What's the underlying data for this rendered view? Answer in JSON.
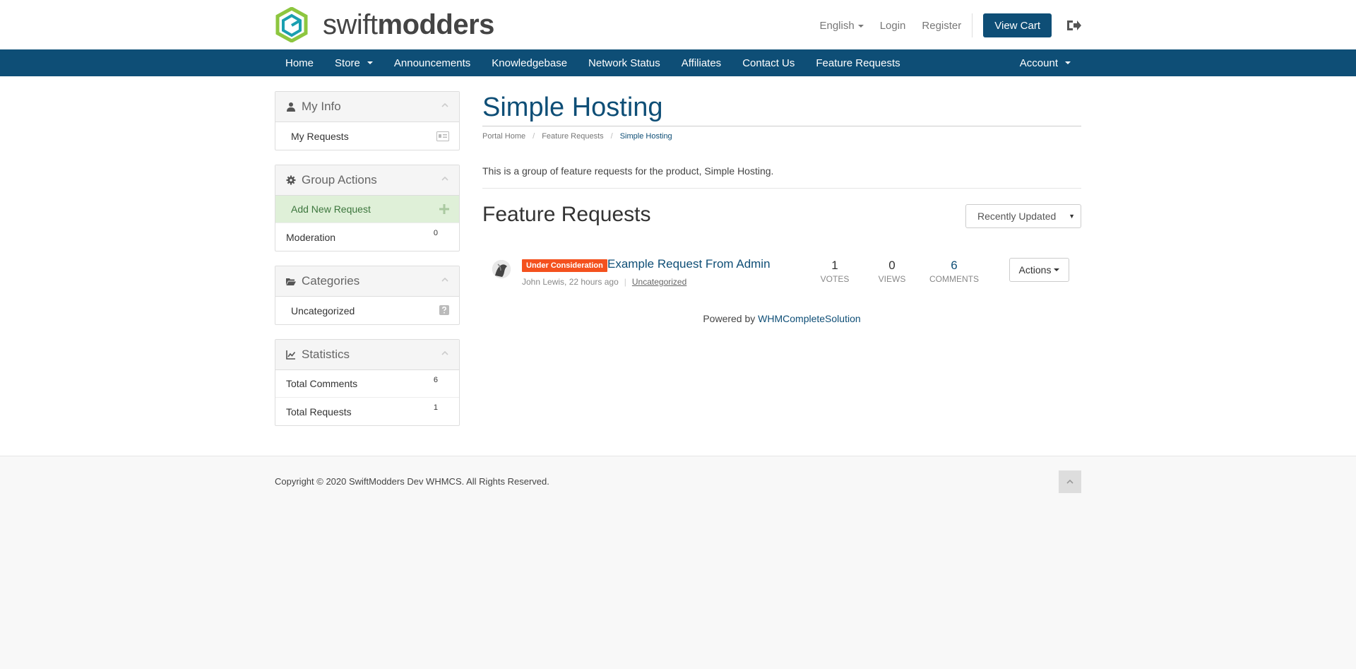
{
  "header": {
    "brand": {
      "part1": "swift",
      "part2": "modders"
    },
    "language": "English",
    "login": "Login",
    "register": "Register",
    "view_cart": "View Cart"
  },
  "nav": {
    "items": [
      "Home",
      "Store",
      "Announcements",
      "Knowledgebase",
      "Network Status",
      "Affiliates",
      "Contact Us",
      "Feature Requests"
    ],
    "account": "Account"
  },
  "sidebar": {
    "my_info": {
      "title": "My Info",
      "items": [
        {
          "label": "My Requests"
        }
      ]
    },
    "group_actions": {
      "title": "Group Actions",
      "add_new": "Add New Request",
      "moderation": "Moderation",
      "moderation_count": "0"
    },
    "categories": {
      "title": "Categories",
      "items": [
        {
          "label": "Uncategorized"
        }
      ]
    },
    "statistics": {
      "title": "Statistics",
      "total_comments_label": "Total Comments",
      "total_comments": "6",
      "total_requests_label": "Total Requests",
      "total_requests": "1"
    }
  },
  "main": {
    "title": "Simple Hosting",
    "breadcrumb": [
      "Portal Home",
      "Feature Requests",
      "Simple Hosting"
    ],
    "intro": "This is a group of feature requests for the product, Simple Hosting.",
    "section_title": "Feature Requests",
    "sort_selected": "Recently Updated",
    "requests": [
      {
        "status": "Under Consideration",
        "title": "Example Request From Admin",
        "author_time": "John Lewis, 22 hours ago",
        "category": "Uncategorized",
        "votes": "1",
        "votes_label": "VOTES",
        "views": "0",
        "views_label": "VIEWS",
        "comments": "6",
        "comments_label": "COMMENTS",
        "actions": "Actions"
      }
    ],
    "powered_by": "Powered by",
    "powered_link": "WHMCompleteSolution"
  },
  "footer": {
    "copyright": "Copyright © 2020 SwiftModders Dev WHMCS. All Rights Reserved."
  },
  "colors": {
    "brand": "#0e4e76",
    "badge": "#f4511e",
    "active_row": "#dff0d8",
    "logo_green": "#8dc63f"
  }
}
